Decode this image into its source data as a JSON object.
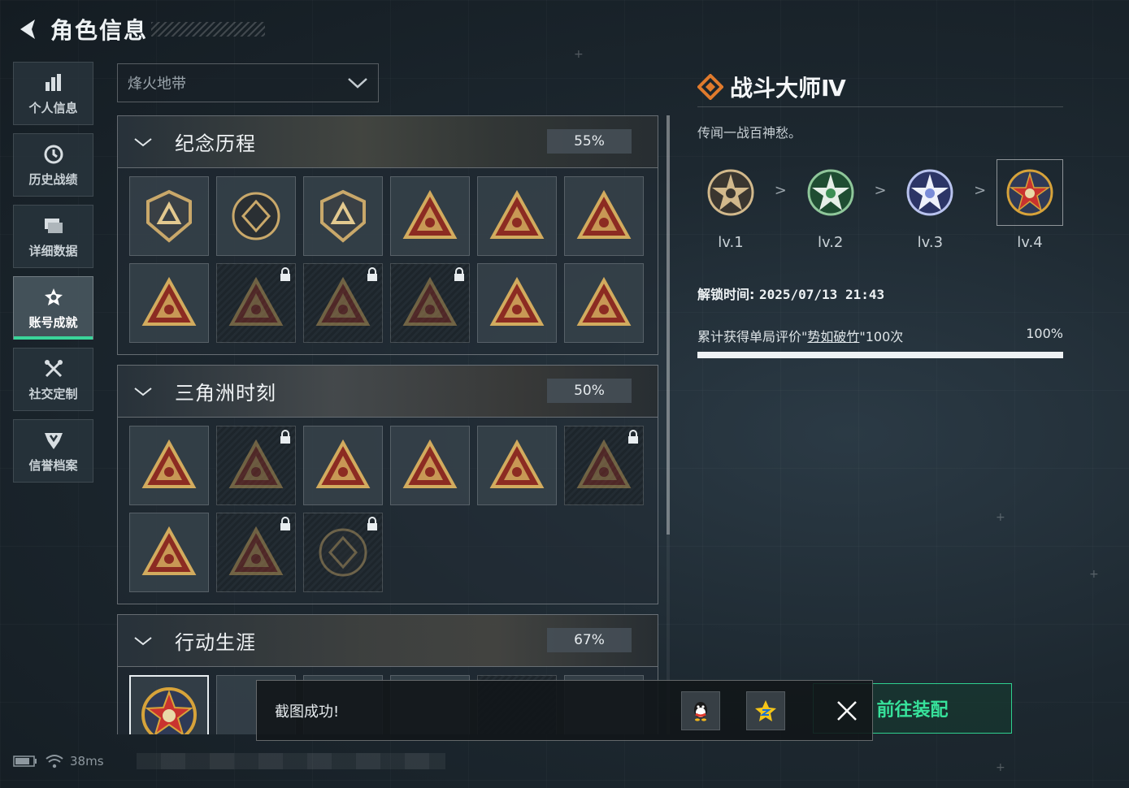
{
  "header": {
    "title": "角色信息"
  },
  "nav": {
    "items": [
      {
        "label": "个人信息",
        "icon": "bar-chart-icon"
      },
      {
        "label": "历史战绩",
        "icon": "clock-icon"
      },
      {
        "label": "详细数据",
        "icon": "folders-icon"
      },
      {
        "label": "账号成就",
        "icon": "medal-icon",
        "active": true
      },
      {
        "label": "社交定制",
        "icon": "tools-icon"
      },
      {
        "label": "信誉档案",
        "icon": "shield-icon"
      }
    ]
  },
  "mode_select": {
    "value": "烽火地带"
  },
  "sections": [
    {
      "title": "纪念历程",
      "percent": "55%",
      "badge_count": 12,
      "locked": [
        7,
        8,
        9
      ]
    },
    {
      "title": "三角洲时刻",
      "percent": "50%",
      "badge_count": 9,
      "locked": [
        1,
        5,
        7,
        8
      ]
    },
    {
      "title": "行动生涯",
      "percent": "67%"
    }
  ],
  "detail": {
    "title": "战斗大师Ⅳ",
    "description": "传闻一战百神愁。",
    "levels": [
      {
        "label": "lv.1",
        "color": "#d2b98c"
      },
      {
        "label": "lv.2",
        "color": "#3d8f55"
      },
      {
        "label": "lv.3",
        "color": "#7a8cd8"
      },
      {
        "label": "lv.4",
        "color": "#d7a33a"
      }
    ],
    "level_separator": ">",
    "unlock_label": "解锁时间:",
    "unlock_time": "2025/07/13 21:43",
    "progress_prefix": "累计获得单局评价\"",
    "progress_link": "势如破竹",
    "progress_suffix": "\"100次",
    "progress_percent": "100%",
    "progress_value": 1.0
  },
  "equip_button": {
    "label": "前往装配"
  },
  "toast": {
    "message": "截图成功!",
    "share_icons": [
      "qq-icon",
      "qzone-star-icon"
    ]
  },
  "status_bar": {
    "ping": "38ms"
  },
  "colors": {
    "accent_green": "#37e29b",
    "gold": "#d7a33a",
    "brand_orange": "#e07a2c"
  }
}
